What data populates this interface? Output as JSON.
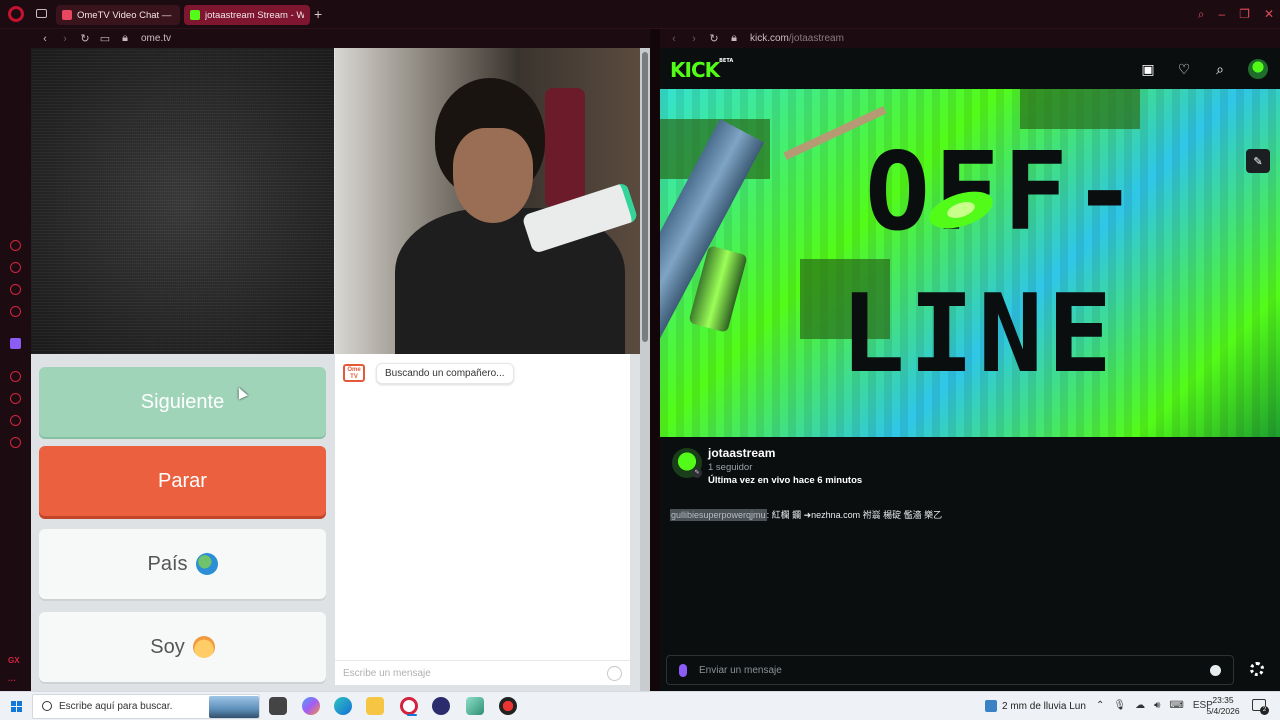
{
  "tabs": [
    {
      "title": "OmeTV Video Chat — Ome",
      "favicon_color": "#e9475f"
    },
    {
      "title": "jotaastream Stream - Watc",
      "favicon_color": "#53fc18"
    }
  ],
  "new_tab_glyph": "+",
  "left_pane": {
    "url": "ome.tv",
    "buttons": {
      "next": "Siguiente",
      "stop": "Parar",
      "country": "País",
      "gender": "Soy"
    },
    "logo_text": "Ome TV",
    "status_bubble": "Buscando un compañero...",
    "chat_placeholder": "Escribe un mensaje"
  },
  "right_pane": {
    "url_host": "kick.com",
    "url_path": "/jotaastream",
    "logo": "KICK",
    "logo_badge": "BETA",
    "banner_lines": [
      "OFF-",
      "LINE"
    ],
    "channel": {
      "name": "jotaastream",
      "followers": "1 seguidor",
      "last_live": "Última vez en vivo hace 6 minutos"
    },
    "chat_message": {
      "user": "gullibiesuperpowerqjmu",
      "text": ": 紅欄 鑭 ➜nezhna.com 祔嵡 楊碇 儖濇 樂乙"
    },
    "chat_placeholder": "Enviar un mensaje",
    "brand_color": "#53fc18"
  },
  "taskbar": {
    "search_placeholder": "Escribe aquí para buscar.",
    "weather": "2 mm de lluvia Lun",
    "language": "ESP",
    "time": "23:35",
    "date": "5/4/2026",
    "notification_count": "2"
  }
}
